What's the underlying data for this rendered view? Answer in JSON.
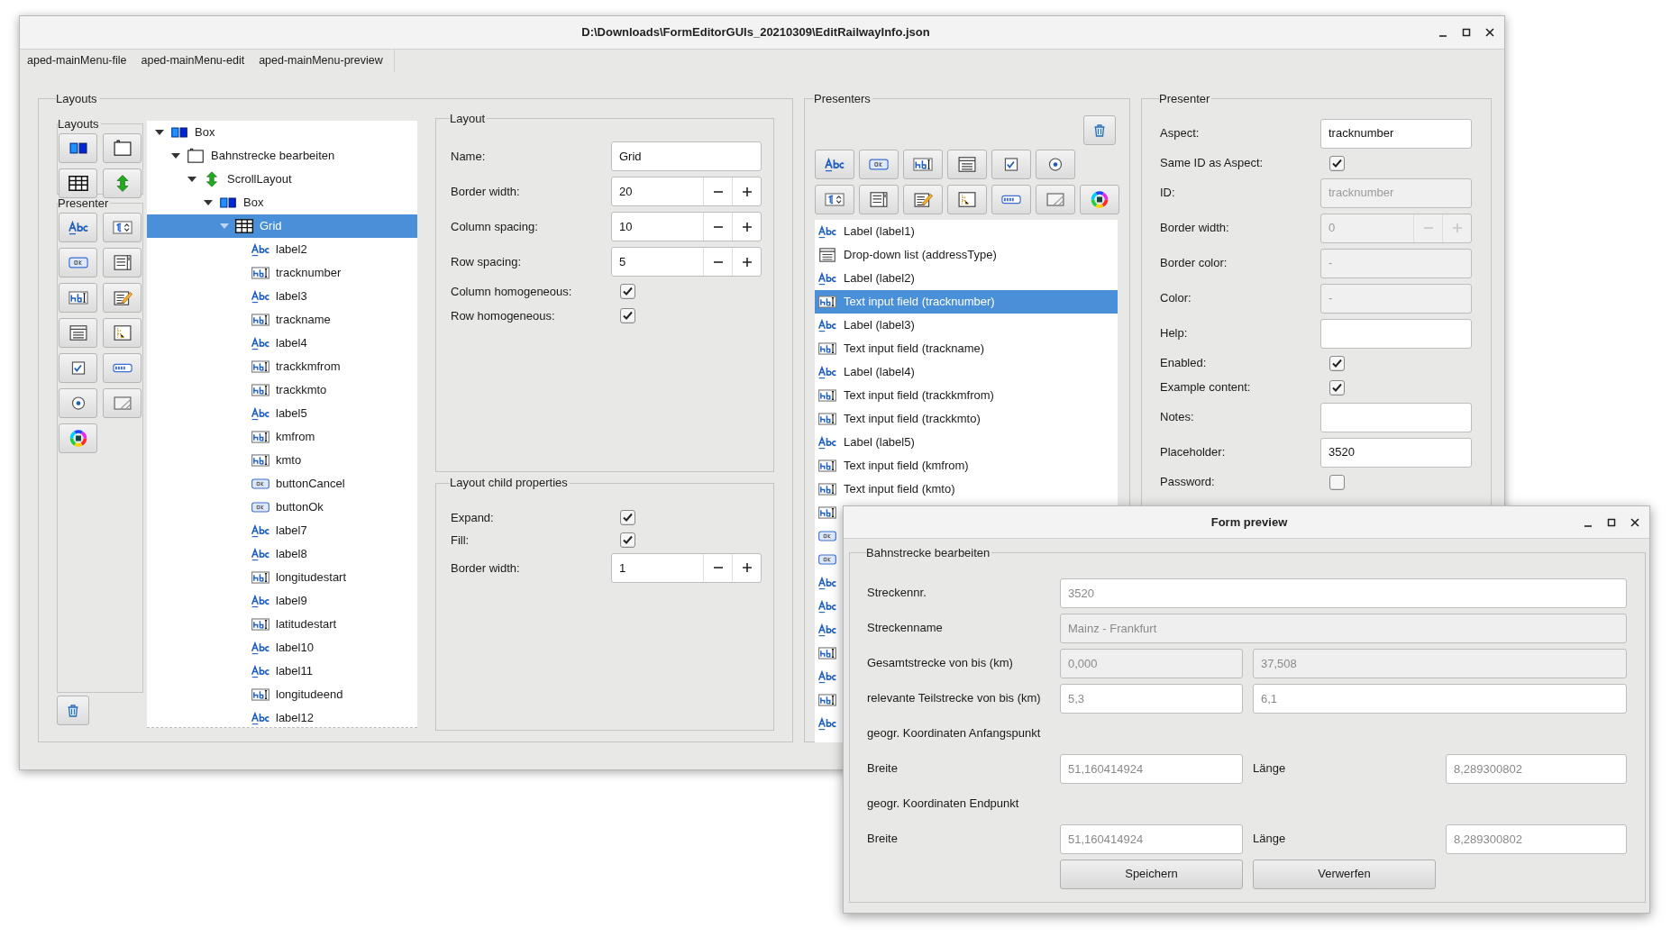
{
  "main_window": {
    "title": "D:\\Downloads\\FormEditorGUIs_20210309\\EditRailwayInfo.json",
    "menu": [
      "aped-mainMenu-file",
      "aped-mainMenu-edit",
      "aped-mainMenu-preview"
    ],
    "layouts_panel": {
      "title": "Layouts",
      "toolbox_layouts_title": "Layouts",
      "toolbox_presenter_title": "Presenter",
      "layout_tools": [
        {
          "kind": "box"
        },
        {
          "kind": "frame"
        },
        {
          "kind": "grid"
        },
        {
          "kind": "scroll"
        }
      ],
      "presenter_tools": [
        {
          "kind": "label"
        },
        {
          "kind": "spin"
        },
        {
          "kind": "button"
        },
        {
          "kind": "list"
        },
        {
          "kind": "text"
        },
        {
          "kind": "textarea"
        },
        {
          "kind": "dropdown"
        },
        {
          "kind": "tree"
        },
        {
          "kind": "checkbox"
        },
        {
          "kind": "progress"
        },
        {
          "kind": "radio"
        },
        {
          "kind": "image"
        },
        {
          "kind": "color"
        }
      ],
      "tree": [
        {
          "label": "Box",
          "kind": "box",
          "expanded": true,
          "selected": false,
          "children": [
            {
              "label": "Bahnstrecke bearbeiten",
              "kind": "frame",
              "expanded": true,
              "selected": false,
              "children": [
                {
                  "label": "ScrollLayout",
                  "kind": "scroll",
                  "expanded": true,
                  "selected": false,
                  "children": [
                    {
                      "label": "Box",
                      "kind": "box",
                      "expanded": true,
                      "selected": false,
                      "children": [
                        {
                          "label": "Grid",
                          "kind": "grid",
                          "expanded": true,
                          "selected": true,
                          "children": [
                            {
                              "label": "label2",
                              "kind": "label",
                              "selected": false
                            },
                            {
                              "label": "tracknumber",
                              "kind": "text",
                              "selected": false
                            },
                            {
                              "label": "label3",
                              "kind": "label",
                              "selected": false
                            },
                            {
                              "label": "trackname",
                              "kind": "text",
                              "selected": false
                            },
                            {
                              "label": "label4",
                              "kind": "label",
                              "selected": false
                            },
                            {
                              "label": "trackkmfrom",
                              "kind": "text",
                              "selected": false
                            },
                            {
                              "label": "trackkmto",
                              "kind": "text",
                              "selected": false
                            },
                            {
                              "label": "label5",
                              "kind": "label",
                              "selected": false
                            },
                            {
                              "label": "kmfrom",
                              "kind": "text",
                              "selected": false
                            },
                            {
                              "label": "kmto",
                              "kind": "text",
                              "selected": false
                            },
                            {
                              "label": "buttonCancel",
                              "kind": "button",
                              "selected": false
                            },
                            {
                              "label": "buttonOk",
                              "kind": "button",
                              "selected": false
                            },
                            {
                              "label": "label7",
                              "kind": "label",
                              "selected": false
                            },
                            {
                              "label": "label8",
                              "kind": "label",
                              "selected": false
                            },
                            {
                              "label": "longitudestart",
                              "kind": "text",
                              "selected": false
                            },
                            {
                              "label": "label9",
                              "kind": "label",
                              "selected": false
                            },
                            {
                              "label": "latitudestart",
                              "kind": "text",
                              "selected": false
                            },
                            {
                              "label": "label10",
                              "kind": "label",
                              "selected": false
                            },
                            {
                              "label": "label11",
                              "kind": "label",
                              "selected": false
                            },
                            {
                              "label": "longitudeend",
                              "kind": "text",
                              "selected": false
                            },
                            {
                              "label": "label12",
                              "kind": "label",
                              "selected": false
                            }
                          ]
                        }
                      ]
                    }
                  ]
                }
              ]
            }
          ]
        }
      ],
      "layout": {
        "title": "Layout",
        "rows": [
          {
            "kind": "text",
            "label": "Name:",
            "value": "Grid"
          },
          {
            "kind": "spin",
            "label": "Border width:",
            "value": "20"
          },
          {
            "kind": "spin",
            "label": "Column spacing:",
            "value": "10"
          },
          {
            "kind": "spin",
            "label": "Row spacing:",
            "value": "5"
          },
          {
            "kind": "check",
            "label": "Column homogeneous:",
            "checked": true
          },
          {
            "kind": "check",
            "label": "Row homogeneous:",
            "checked": true
          }
        ]
      },
      "child_properties": {
        "title": "Layout child properties",
        "rows": [
          {
            "kind": "check",
            "label": "Expand:",
            "checked": true
          },
          {
            "kind": "check",
            "label": "Fill:",
            "checked": true
          },
          {
            "kind": "spin",
            "label": "Border width:",
            "value": "1"
          }
        ]
      }
    },
    "presenters_panel": {
      "title": "Presenters",
      "tools_row_1": [
        {
          "kind": "label"
        },
        {
          "kind": "button"
        },
        {
          "kind": "text"
        },
        {
          "kind": "dropdown"
        },
        {
          "kind": "checkbox"
        },
        {
          "kind": "radio"
        }
      ],
      "tools_row_2": [
        {
          "kind": "spin"
        },
        {
          "kind": "list"
        },
        {
          "kind": "textarea"
        },
        {
          "kind": "tree"
        },
        {
          "kind": "progress"
        },
        {
          "kind": "image"
        },
        {
          "kind": "color"
        }
      ],
      "items": [
        {
          "kind": "label",
          "text": "Label (label1)",
          "selected": false
        },
        {
          "kind": "dropdown",
          "text": "Drop-down list (addressType)",
          "selected": false
        },
        {
          "kind": "label",
          "text": "Label (label2)",
          "selected": false
        },
        {
          "kind": "text",
          "text": "Text input field (tracknumber)",
          "selected": true
        },
        {
          "kind": "label",
          "text": "Label (label3)",
          "selected": false
        },
        {
          "kind": "text",
          "text": "Text input field (trackname)",
          "selected": false
        },
        {
          "kind": "label",
          "text": "Label (label4)",
          "selected": false
        },
        {
          "kind": "text",
          "text": "Text input field (trackkmfrom)",
          "selected": false
        },
        {
          "kind": "text",
          "text": "Text input field (trackkmto)",
          "selected": false
        },
        {
          "kind": "label",
          "text": "Label (label5)",
          "selected": false
        },
        {
          "kind": "text",
          "text": "Text input field (kmfrom)",
          "selected": false
        },
        {
          "kind": "text",
          "text": "Text input field (kmto)",
          "selected": false
        },
        {
          "kind": "text",
          "selected": false
        },
        {
          "kind": "button",
          "selected": false
        },
        {
          "kind": "button",
          "selected": false
        },
        {
          "kind": "label",
          "selected": false
        },
        {
          "kind": "label",
          "selected": false
        },
        {
          "kind": "label",
          "selected": false
        },
        {
          "kind": "text",
          "selected": false
        },
        {
          "kind": "label",
          "selected": false
        },
        {
          "kind": "text",
          "selected": false
        },
        {
          "kind": "label",
          "selected": false
        }
      ]
    },
    "presenter_panel": {
      "title": "Presenter",
      "rows": [
        {
          "kind": "text",
          "label": "Aspect:",
          "value": "tracknumber",
          "disabled": false
        },
        {
          "kind": "check",
          "label": "Same ID as Aspect:",
          "checked": true
        },
        {
          "kind": "text",
          "label": "ID:",
          "value": "tracknumber",
          "disabled": true
        },
        {
          "kind": "spin",
          "label": "Border width:",
          "value": "0",
          "disabled": true
        },
        {
          "kind": "text",
          "label": "Border color:",
          "value": "-",
          "disabled": true
        },
        {
          "kind": "text",
          "label": "Color:",
          "value": "-",
          "disabled": true
        },
        {
          "kind": "text",
          "label": "Help:",
          "disabled": false
        },
        {
          "kind": "check",
          "label": "Enabled:",
          "checked": true
        },
        {
          "kind": "check",
          "label": "Example content:",
          "checked": true
        },
        {
          "kind": "text",
          "label": "Notes:",
          "disabled": false
        },
        {
          "kind": "text",
          "label": "Placeholder:",
          "value": "3520",
          "disabled": false
        },
        {
          "kind": "check",
          "label": "Password:",
          "checked": false
        }
      ]
    }
  },
  "preview_window": {
    "title": "Form preview",
    "group_title": "Bahnstrecke bearbeiten",
    "rows": [
      {
        "kind": "single",
        "label": "Streckennr.",
        "fields": [
          {
            "placeholder": "3520",
            "disabled": false
          }
        ]
      },
      {
        "kind": "single",
        "label": "Streckenname",
        "fields": [
          {
            "placeholder": "Mainz - Frankfurt",
            "disabled": true
          }
        ]
      },
      {
        "kind": "range",
        "label": "Gesamtstrecke von bis (km)",
        "fields": [
          {
            "placeholder": "0,000",
            "disabled": true
          },
          {
            "placeholder": "37,508",
            "disabled": true
          }
        ]
      },
      {
        "kind": "range",
        "label": "relevante Teilstrecke von bis (km)",
        "fields": [
          {
            "placeholder": "5,3",
            "disabled": false
          },
          {
            "placeholder": "6,1",
            "disabled": false
          }
        ]
      },
      {
        "kind": "heading",
        "label": "geogr. Koordinaten Anfangspunkt"
      },
      {
        "kind": "pair",
        "label": "Breite",
        "label_2": "Länge",
        "fields": [
          {
            "placeholder": "51,160414924",
            "disabled": false
          },
          {
            "placeholder": "8,289300802",
            "disabled": false
          }
        ]
      },
      {
        "kind": "heading",
        "label": "geogr. Koordinaten Endpunkt"
      },
      {
        "kind": "pair",
        "label": "Breite",
        "label_2": "Länge",
        "fields": [
          {
            "placeholder": "51,160414924",
            "disabled": false
          },
          {
            "placeholder": "8,289300802",
            "disabled": false
          }
        ]
      },
      {
        "kind": "buttons",
        "buttons": [
          "Speichern",
          "Verwerfen"
        ]
      }
    ]
  }
}
